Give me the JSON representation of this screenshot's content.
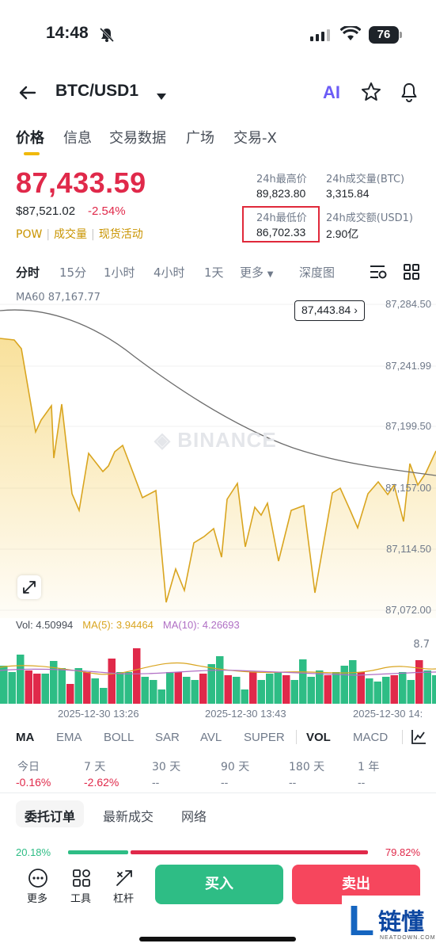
{
  "status_bar": {
    "time": "14:48",
    "battery": "76"
  },
  "header": {
    "pair": "BTC/USD1",
    "ai_label": "AI"
  },
  "tabs": [
    "价格",
    "信息",
    "交易数据",
    "广场",
    "交易-X"
  ],
  "price": {
    "last": "87,433.59",
    "usd": "$87,521.02",
    "change": "-2.54%",
    "tags": [
      "POW",
      "成交量",
      "现货活动"
    ]
  },
  "stats": {
    "high_label": "24h最高价",
    "high_value": "89,823.80",
    "vol_btc_label": "24h成交量(BTC)",
    "vol_btc_value": "3,315.84",
    "low_label": "24h最低价",
    "low_value": "86,702.33",
    "vol_usd_label": "24h成交额(USD1)",
    "vol_usd_value": "2.90亿"
  },
  "intervals": [
    "分时",
    "15分",
    "1小时",
    "4小时",
    "1天",
    "更多",
    "深度图"
  ],
  "chart": {
    "ma60_label": "MA60 87,167.77",
    "current_price_tag": "87,443.84",
    "watermark": "BINANCE",
    "y_labels": [
      "87,284.50",
      "87,241.99",
      "87,199.50",
      "87,157.00",
      "87,114.50",
      "87,072.00"
    ],
    "line_color": "#d9a520",
    "ma_color": "#6c6c6c"
  },
  "volume": {
    "vol_label": "Vol: 4.50994",
    "ma5_label": "MA(5): 3.94464",
    "ma10_label": "MA(10): 4.26693",
    "max_label": "8.7",
    "ma5_color": "#d9a520",
    "ma10_color": "#b06fc4",
    "up_color": "#2ebd85",
    "down_color": "#e0294a"
  },
  "time_labels": [
    "2025-12-30 13:26",
    "2025-12-30 13:43",
    "2025-12-30 14:"
  ],
  "indicators": [
    "MA",
    "EMA",
    "BOLL",
    "SAR",
    "AVL",
    "SUPER",
    "VOL",
    "MACD"
  ],
  "performance": [
    {
      "label": "今日",
      "value": "-0.16%"
    },
    {
      "label": "7 天",
      "value": "-2.62%"
    },
    {
      "label": "30 天",
      "value": "--"
    },
    {
      "label": "90 天",
      "value": "--"
    },
    {
      "label": "180 天",
      "value": "--"
    },
    {
      "label": "1 年",
      "value": "--"
    }
  ],
  "order_tabs": [
    "委托订单",
    "最新成交",
    "网络"
  ],
  "depth": {
    "buy_pct": "20.18%",
    "sell_pct": "79.82%",
    "buy_ratio": 0.2018
  },
  "bottom_bar": {
    "more": "更多",
    "tools": "工具",
    "leverage": "杠杆",
    "buy": "买入",
    "sell": "卖出"
  },
  "corner_logo": {
    "brand": "链懂",
    "sub": "NEATDOWN.COM"
  }
}
